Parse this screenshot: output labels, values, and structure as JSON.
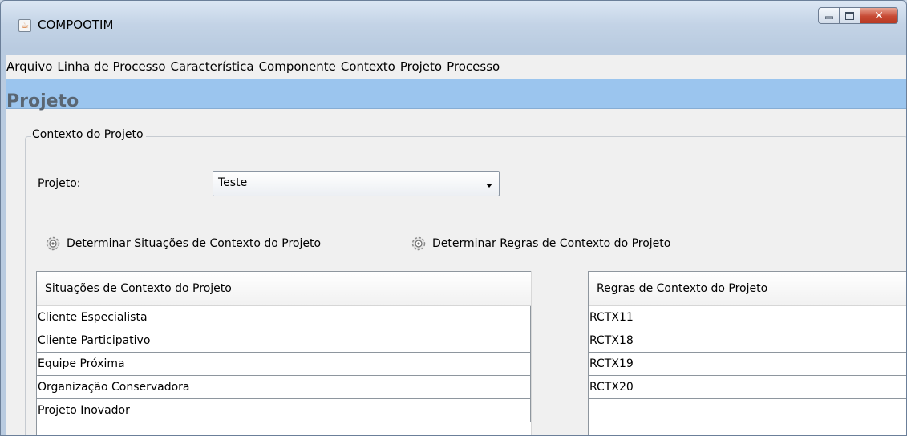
{
  "window": {
    "title": "COMPOOTIM"
  },
  "menu": [
    "Arquivo",
    "Linha de Processo",
    "Característica",
    "Componente",
    "Contexto",
    "Projeto",
    "Processo"
  ],
  "section": {
    "title": "Projeto"
  },
  "group": {
    "label": "Contexto do Projeto"
  },
  "project": {
    "label": "Projeto:",
    "selected": "Teste"
  },
  "actions": {
    "situations": "Determinar Situações de Contexto do Projeto",
    "rules": "Determinar Regras de Contexto do Projeto"
  },
  "situations_table": {
    "header": "Situações de Contexto do Projeto",
    "rows": [
      "Cliente Especialista",
      "Cliente Participativo",
      "Equipe Próxima",
      "Organização Conservadora",
      "Projeto Inovador"
    ]
  },
  "rules_table": {
    "header": "Regras de Contexto do Projeto",
    "rows": [
      "RCTX11",
      "RCTX18",
      "RCTX19",
      "RCTX20"
    ]
  },
  "icons": {
    "app": "java-app-icon",
    "actions": "gear-icon"
  },
  "colors": {
    "section_header_bg": "#9bc5ee",
    "section_title": "#5a6672",
    "close_button": "#c74a34"
  }
}
